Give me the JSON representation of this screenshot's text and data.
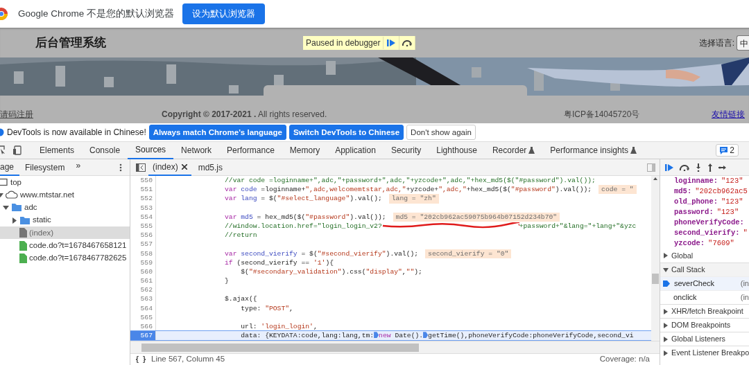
{
  "chrome_bar": {
    "message": "Google Chrome 不是您的默认浏览器",
    "button": "设为默认浏览器"
  },
  "page": {
    "title": "后台管理系统",
    "paused_label": "Paused in debugger",
    "language_label": "选择语言:",
    "language_value": "中",
    "footer": [
      {
        "kind": "link",
        "text": "请码注册"
      },
      {
        "kind": "text",
        "text": "**Copyright © 2017-2021 .** All rights reserved."
      },
      {
        "kind": "text",
        "text": "粤ICP备14045720号"
      },
      {
        "kind": "link",
        "text": "友情链接"
      }
    ]
  },
  "infobar": {
    "message": "DevTools is now available in Chinese!",
    "buttons": [
      {
        "label": "Always match Chrome's language",
        "primary": true
      },
      {
        "label": "Switch DevTools to Chinese",
        "primary": true
      },
      {
        "label": "Don't show again",
        "primary": false
      }
    ]
  },
  "panel_tabs": [
    {
      "label": "Elements",
      "selected": false,
      "experimental": false
    },
    {
      "label": "Console",
      "selected": false,
      "experimental": false
    },
    {
      "label": "Sources",
      "selected": true,
      "experimental": false
    },
    {
      "label": "Network",
      "selected": false,
      "experimental": false
    },
    {
      "label": "Performance",
      "selected": false,
      "experimental": false
    },
    {
      "label": "Memory",
      "selected": false,
      "experimental": false
    },
    {
      "label": "Application",
      "selected": false,
      "experimental": false
    },
    {
      "label": "Security",
      "selected": false,
      "experimental": false
    },
    {
      "label": "Lighthouse",
      "selected": false,
      "experimental": false
    },
    {
      "label": "Recorder",
      "selected": false,
      "experimental": true
    },
    {
      "label": "Performance insights",
      "selected": false,
      "experimental": true
    }
  ],
  "issues_count": "2",
  "navigator": {
    "tabs": [
      {
        "label": "age",
        "selected": true
      },
      {
        "label": "Filesystem",
        "selected": false
      }
    ],
    "more": "»",
    "tree": [
      {
        "label": "top",
        "kind": "frame",
        "selected": false,
        "children": [
          {
            "label": "www.mtstar.net",
            "kind": "domain",
            "expanded": true,
            "selected": false,
            "children": [
              {
                "label": "adc",
                "kind": "folder",
                "expanded": true,
                "selected": false,
                "children": [
                  {
                    "label": "static",
                    "kind": "folder",
                    "expanded": false,
                    "selected": false
                  },
                  {
                    "label": "(index)",
                    "kind": "document",
                    "selected": true
                  },
                  {
                    "label": "code.do?t=1678467658121",
                    "kind": "script",
                    "selected": false
                  },
                  {
                    "label": "code.do?t=1678467782625",
                    "kind": "script",
                    "selected": false
                  }
                ]
              }
            ]
          }
        ]
      }
    ]
  },
  "editor": {
    "tabs": [
      {
        "label": "(index)",
        "selected": true,
        "closable": true
      },
      {
        "label": "md5.js",
        "selected": false,
        "closable": false
      }
    ],
    "lines": [
      {
        "number": "550",
        "current": false,
        "tokens": [
          {
            "kind": "comment",
            "text": "//var code =loginname+\",adc,\"+password+\",adc,\"+yzcode+\",adc,\"+hex_md5($(\"#password\").val());"
          }
        ]
      },
      {
        "number": "551",
        "current": false,
        "tokens": [
          {
            "kind": "keyword",
            "text": "var"
          },
          {
            "kind": "def",
            "text": " code"
          },
          {
            "kind": "plain",
            "text": " =loginname+"
          },
          {
            "kind": "string",
            "text": "\",adc,welcomemtstar,adc,\""
          },
          {
            "kind": "plain",
            "text": "+yzcode+"
          },
          {
            "kind": "string",
            "text": "\",adc,\""
          },
          {
            "kind": "plain",
            "text": "+hex_md5($("
          },
          {
            "kind": "string",
            "text": "\"#password\""
          },
          {
            "kind": "plain",
            "text": ").val());"
          }
        ],
        "inline_value": "code = \""
      },
      {
        "number": "552",
        "current": false,
        "tokens": [
          {
            "kind": "keyword",
            "text": "var"
          },
          {
            "kind": "def",
            "text": " lang"
          },
          {
            "kind": "plain",
            "text": " = $("
          },
          {
            "kind": "string",
            "text": "\"#select_language\""
          },
          {
            "kind": "plain",
            "text": ").val();"
          }
        ],
        "inline_value": "lang = \"zh\""
      },
      {
        "number": "553",
        "current": false
      },
      {
        "number": "554",
        "current": false,
        "tokens": [
          {
            "kind": "keyword",
            "text": "var"
          },
          {
            "kind": "def",
            "text": " md5"
          },
          {
            "kind": "plain",
            "text": " = hex_md5($("
          },
          {
            "kind": "string",
            "text": "\"#password\""
          },
          {
            "kind": "plain",
            "text": ").val());"
          }
        ],
        "inline_value": "md5 = \"202cb962ac59075b964b07152d234b70\""
      },
      {
        "number": "555",
        "current": false,
        "tokens": [
          {
            "kind": "comment",
            "text": "//window.location.href=\"login_login_v2?"
          },
          {
            "kind": "scribble"
          },
          {
            "kind": "comment",
            "text": "+password+\"&lang=\"+lang+\"&yzc"
          }
        ]
      },
      {
        "number": "556",
        "current": false,
        "tokens": [
          {
            "kind": "comment",
            "text": "//return"
          }
        ]
      },
      {
        "number": "557",
        "current": false
      },
      {
        "number": "558",
        "current": false,
        "tokens": [
          {
            "kind": "keyword",
            "text": "var"
          },
          {
            "kind": "def",
            "text": " second_vierify"
          },
          {
            "kind": "plain",
            "text": " = $("
          },
          {
            "kind": "string",
            "text": "\"#second_vierify\""
          },
          {
            "kind": "plain",
            "text": ").val();"
          }
        ],
        "inline_value": "second_vierify = \"0\""
      },
      {
        "number": "559",
        "current": false,
        "tokens": [
          {
            "kind": "keyword",
            "text": "if"
          },
          {
            "kind": "plain",
            "text": " (second_vierify == "
          },
          {
            "kind": "string",
            "text": "'1'"
          },
          {
            "kind": "plain",
            "text": "){"
          }
        ]
      },
      {
        "number": "560",
        "current": false,
        "tokens": [
          {
            "kind": "plain",
            "text": "    $("
          },
          {
            "kind": "string",
            "text": "\"#secondary_validation\""
          },
          {
            "kind": "plain",
            "text": ").css("
          },
          {
            "kind": "string",
            "text": "\"display\""
          },
          {
            "kind": "plain",
            "text": ","
          },
          {
            "kind": "string",
            "text": "\"\""
          },
          {
            "kind": "plain",
            "text": ");"
          }
        ]
      },
      {
        "number": "561",
        "current": false,
        "tokens": [
          {
            "kind": "plain",
            "text": "}"
          }
        ]
      },
      {
        "number": "562",
        "current": false
      },
      {
        "number": "563",
        "current": false,
        "tokens": [
          {
            "kind": "plain",
            "text": "$.ajax({"
          }
        ]
      },
      {
        "number": "564",
        "current": false,
        "tokens": [
          {
            "kind": "plain",
            "text": "    type: "
          },
          {
            "kind": "string",
            "text": "\"POST\""
          },
          {
            "kind": "plain",
            "text": ","
          }
        ]
      },
      {
        "number": "565",
        "current": false
      },
      {
        "number": "566",
        "current": false,
        "tokens": [
          {
            "kind": "plain",
            "text": "    url: "
          },
          {
            "kind": "string",
            "text": "'login_login'"
          },
          {
            "kind": "plain",
            "text": ","
          }
        ]
      },
      {
        "number": "567",
        "current": true,
        "tokens": [
          {
            "kind": "plain",
            "text": "    data: {KEYDATA:code,lang:lang,tm:"
          },
          {
            "kind": "marker"
          },
          {
            "kind": "keyword",
            "text": "new"
          },
          {
            "kind": "plain",
            "text": " Date()."
          },
          {
            "kind": "marker"
          },
          {
            "kind": "plain",
            "text": "getTime(),phoneVerifyCode:phoneVerifyCode,second_vi"
          }
        ]
      }
    ],
    "status": "Line 567, Column 45",
    "coverage": "Coverage: n/a"
  },
  "debugger": {
    "scope": [
      {
        "name": "loginname:",
        "value": "\"123\""
      },
      {
        "name": "md5:",
        "value": "\"202cb962ac5"
      },
      {
        "name": "old_phone:",
        "value": "\"123\""
      },
      {
        "name": "password:",
        "value": "\"123\""
      },
      {
        "name": "phoneVerifyCode:"
      },
      {
        "name": "second_vierify:",
        "value": "\""
      },
      {
        "name": "yzcode:",
        "value": "\"7609\""
      }
    ],
    "global": {
      "label": "Global",
      "expanded": false
    },
    "call_stack": {
      "label": "Call Stack",
      "expanded": true,
      "frames": [
        {
          "name": "severCheck",
          "location": "(in",
          "selected": true
        },
        {
          "name": "onclick",
          "location": "(in",
          "selected": false
        }
      ]
    },
    "sections": [
      {
        "label": "XHR/fetch Breakpoint",
        "expanded": false
      },
      {
        "label": "DOM Breakpoints",
        "expanded": false
      },
      {
        "label": "Global Listeners",
        "expanded": false
      },
      {
        "label": "Event Listener Breakpo",
        "expanded": false
      }
    ]
  }
}
